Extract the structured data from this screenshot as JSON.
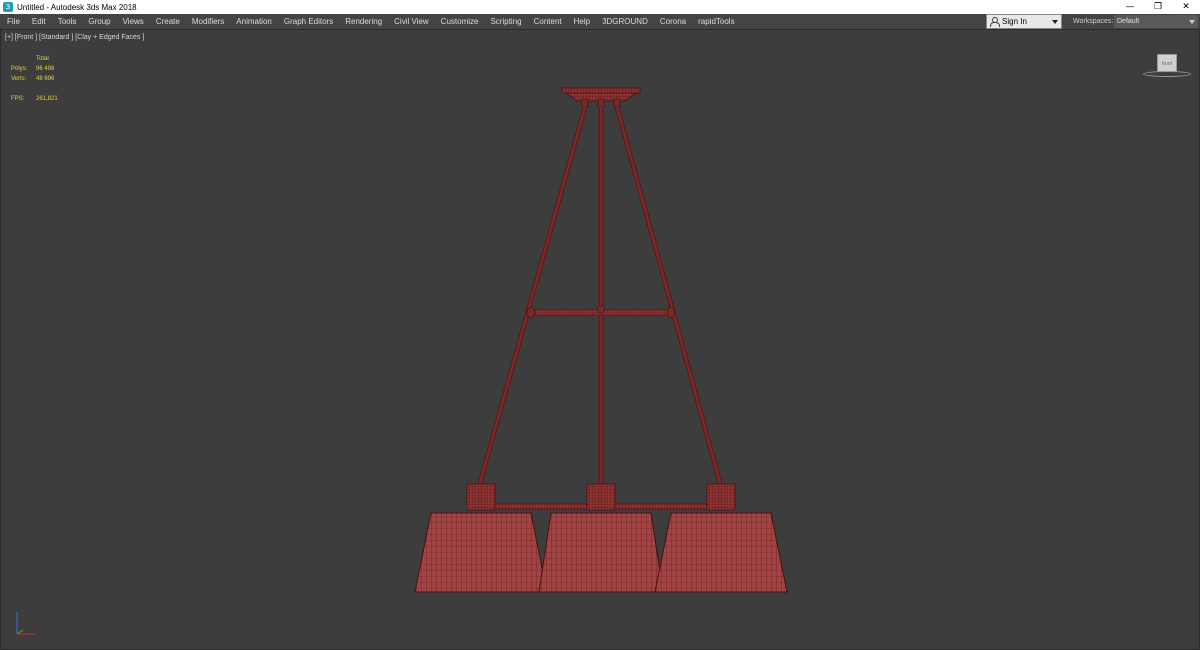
{
  "window": {
    "title": "Untitled - Autodesk 3ds Max 2018",
    "buttons": [
      "—",
      "❐",
      "✕"
    ]
  },
  "menubar": {
    "items": [
      "File",
      "Edit",
      "Tools",
      "Group",
      "Views",
      "Create",
      "Modifiers",
      "Animation",
      "Graph Editors",
      "Rendering",
      "Civil View",
      "Customize",
      "Scripting",
      "Content",
      "Help",
      "3DGROUND",
      "Corona",
      "rapidTools"
    ],
    "sign_in": "Sign In",
    "workspaces_label": "Workspaces:",
    "workspaces_value": "Default"
  },
  "viewport": {
    "label": "[+] [Front ] [Standard ] [Clay + Edged Faces ]",
    "stats": {
      "total_label": "Total",
      "polys_label": "Polys:",
      "polys_value": "96 498",
      "verts_label": "Verts:",
      "verts_value": "48 696",
      "fps_label": "FPS:",
      "fps_value": "261,821"
    },
    "viewcube_label": "front"
  },
  "colors": {
    "viewport_bg": "#3d3d3d",
    "model_fill": "#9a3a3a",
    "model_wire": "#5a1414",
    "stats_text": "#e6d040"
  },
  "icons": {
    "app": "3ds-max-icon",
    "user": "user-icon",
    "dropdown": "chevron-down-icon"
  }
}
